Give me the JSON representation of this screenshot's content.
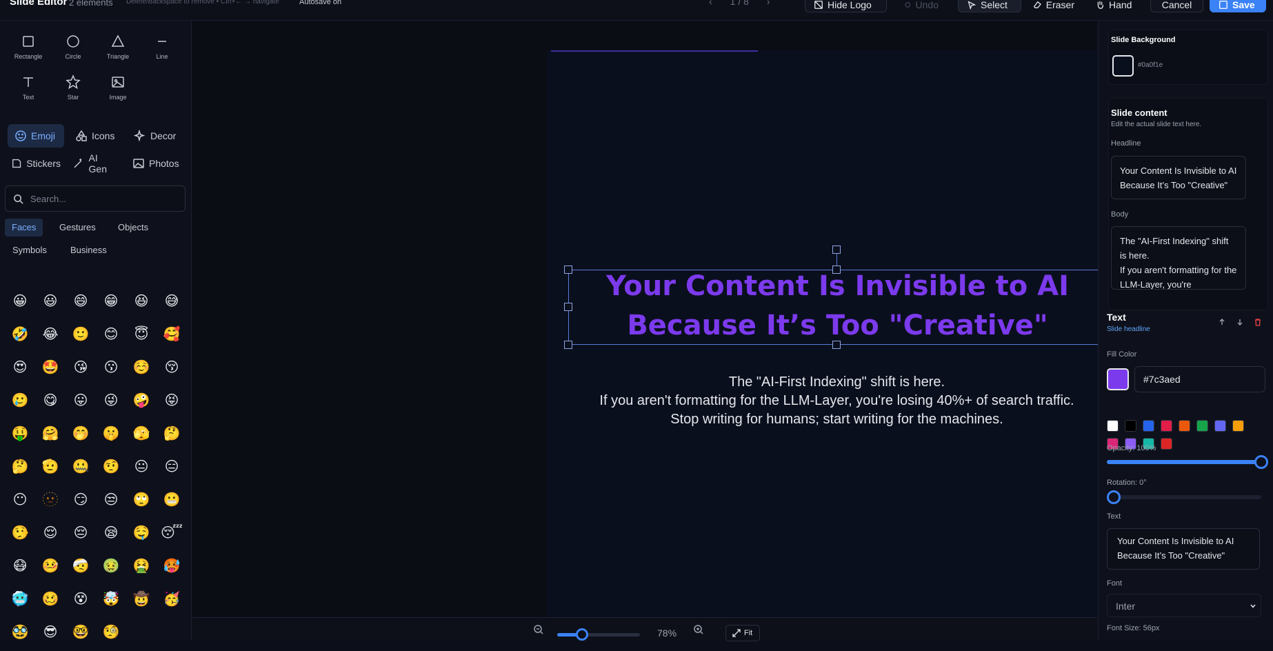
{
  "header": {
    "title": "Slide Editor",
    "element_count": "2 elements",
    "hint": "Delete/Backspace to remove • Ctrl+← → navigate",
    "autosave": "Autosave on",
    "page_indicator": "1 / 8",
    "hide_logo": "Hide Logo",
    "undo": "Undo",
    "select": "Select",
    "eraser": "Eraser",
    "hand": "Hand",
    "cancel": "Cancel",
    "save": "Save"
  },
  "shapes": [
    {
      "label": "Rectangle",
      "icon": "rectangle-icon"
    },
    {
      "label": "Circle",
      "icon": "circle-icon"
    },
    {
      "label": "Triangle",
      "icon": "triangle-icon"
    },
    {
      "label": "Line",
      "icon": "line-icon"
    },
    {
      "label": "Text",
      "icon": "text-icon"
    },
    {
      "label": "Star",
      "icon": "star-icon"
    },
    {
      "label": "Image",
      "icon": "image-icon"
    }
  ],
  "asset_tabs": [
    "Emoji",
    "Icons",
    "Decor",
    "Stickers",
    "AI Gen",
    "Photos"
  ],
  "search": {
    "placeholder": "Search..."
  },
  "emoji_categories": [
    "Faces",
    "Gestures",
    "Objects",
    "Symbols",
    "Business"
  ],
  "emojis": [
    "😀",
    "😃",
    "😄",
    "😁",
    "😆",
    "😅",
    "🤣",
    "😂",
    "🙂",
    "😊",
    "😇",
    "🥰",
    "😍",
    "🤩",
    "😘",
    "😗",
    "☺️",
    "😚",
    "🥲",
    "😋",
    "😛",
    "😜",
    "🤪",
    "😝",
    "🤑",
    "🤗",
    "🤭",
    "🤫",
    "🫣",
    "🤔",
    "🤔",
    "🫡",
    "🤐",
    "🤨",
    "😐",
    "😑",
    "😶",
    "🫥",
    "😏",
    "😒",
    "🙄",
    "😬",
    "🤥",
    "😌",
    "😔",
    "😪",
    "🤤",
    "😴",
    "😷",
    "🤒",
    "🤕",
    "🤢",
    "🤮",
    "🥵",
    "🥶",
    "🥴",
    "😵",
    "🤯",
    "🤠",
    "🥳",
    "🥸",
    "😎",
    "🤓",
    "🧐"
  ],
  "slide": {
    "headline": "Your Content Is Invisible to AI Because It’s Too \"Creative\"",
    "body_lines": [
      "The \"AI-First Indexing\" shift is here.",
      "If you aren't formatting for the LLM-Layer, you're losing 40%+ of search traffic.",
      "Stop writing for humans; start writing for the machines."
    ],
    "headline_color": "#7c3aed",
    "background": "#0a0f1e"
  },
  "zoom": {
    "label": "78%",
    "fraction": 0.78,
    "fit": "Fit"
  },
  "panel": {
    "bg_title": "Slide Background",
    "bg_value": "#0a0f1e",
    "content_title": "Slide content",
    "content_desc": "Edit the actual slide text here.",
    "headline_label": "Headline",
    "headline_value": "Your Content Is Invisible to AI Because It’s Too \"Creative\"",
    "body_label": "Body",
    "body_value": "The \"AI-First Indexing\" shift is here.\nIf you aren't formatting for the LLM-Layer, you're",
    "element_title": "Text",
    "element_sub": "Slide headline",
    "fill_label": "Fill Color",
    "fill_value": "#7c3aed",
    "swatches": [
      "#ffffff",
      "#000000",
      "#2563eb",
      "#e11d48",
      "#ea580c",
      "#16a34a",
      "#6366f1",
      "#f59e0b",
      "#db2777",
      "#8b5cf6",
      "#14b8a6",
      "#dc2626"
    ],
    "opacity_label": "Opacity: 100%",
    "opacity": 1.0,
    "rotation_label": "Rotation: 0°",
    "rotation": 0,
    "text_label": "Text",
    "text_value": "Your Content Is Invisible to AI Because It’s Too \"Creative\"",
    "font_label": "Font",
    "font_value": "Inter",
    "font_size_label": "Font Size: 56px"
  }
}
